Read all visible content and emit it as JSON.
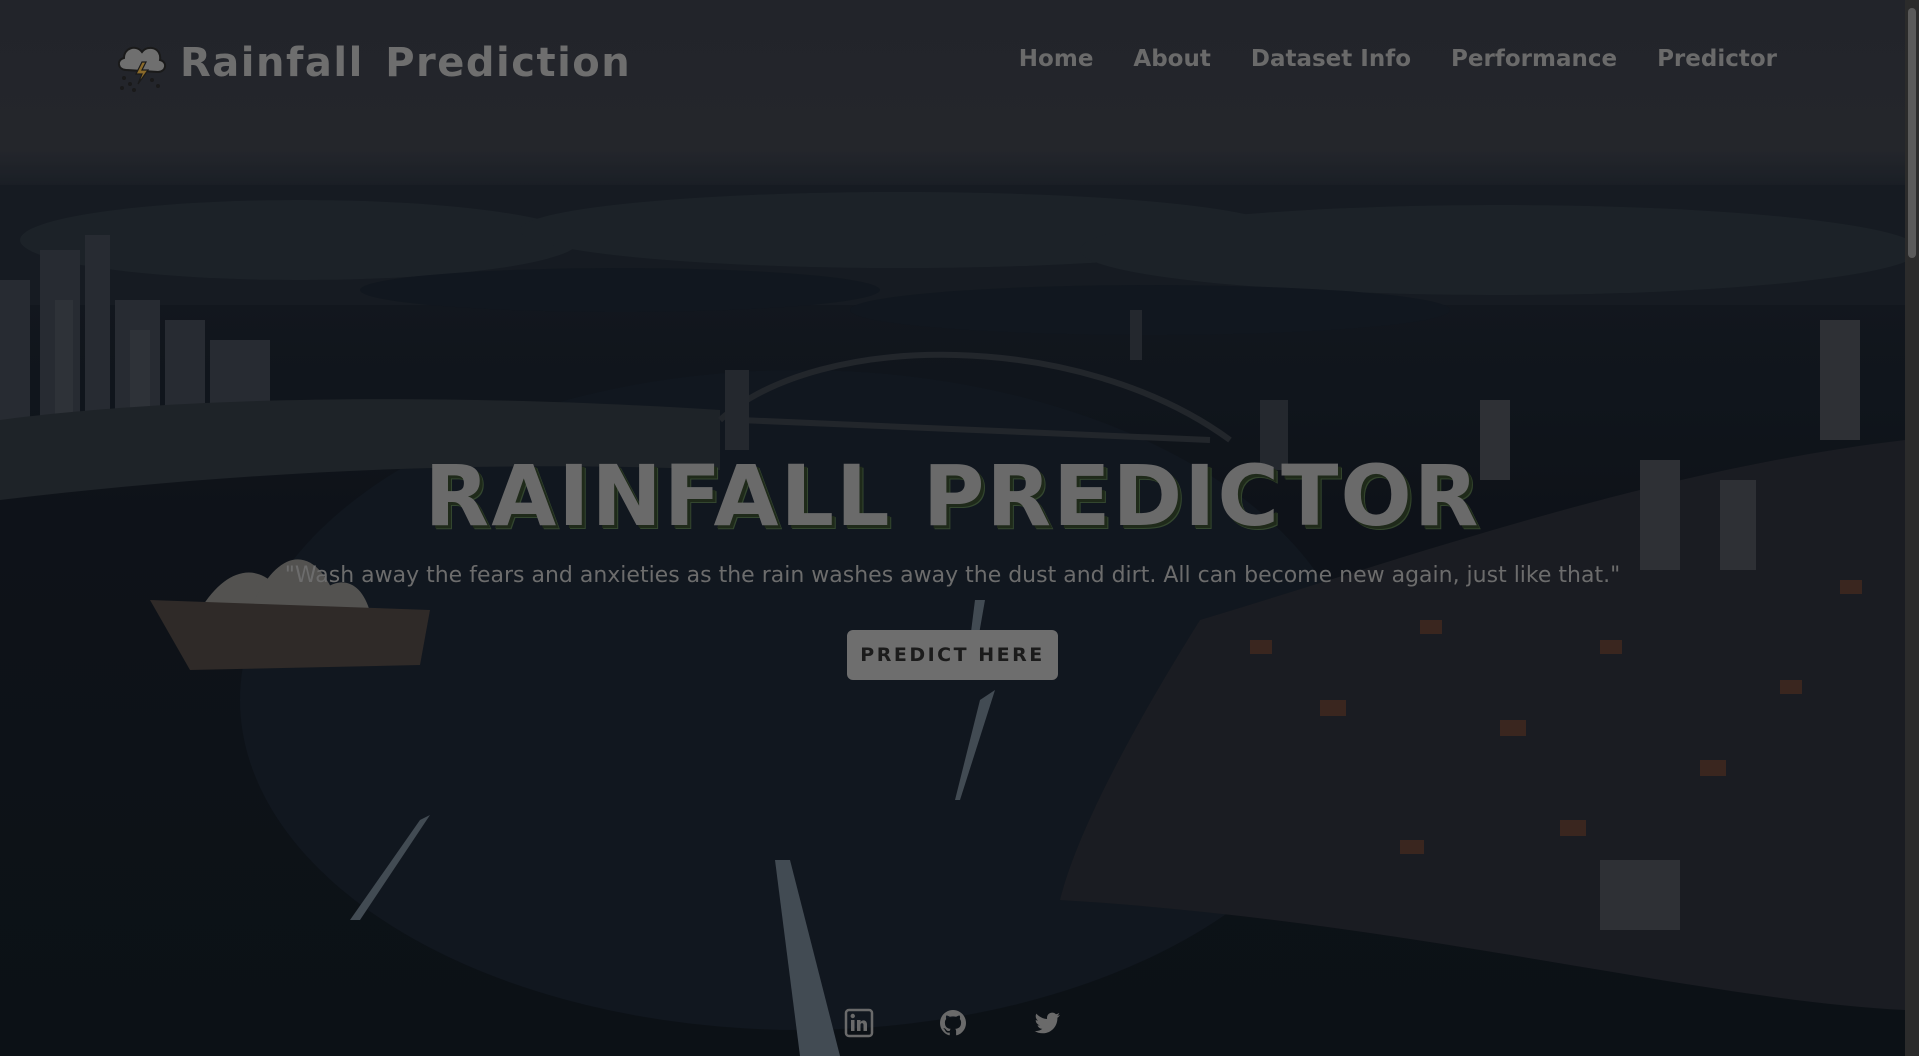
{
  "brand": {
    "title": "Rainfall Prediction",
    "icon": "thunderstorm-cloud-icon"
  },
  "nav": {
    "items": [
      {
        "label": "Home"
      },
      {
        "label": "About"
      },
      {
        "label": "Dataset Info"
      },
      {
        "label": "Performance"
      },
      {
        "label": "Predictor"
      }
    ]
  },
  "hero": {
    "title": "RAINFALL PREDICTOR",
    "quote": "\"Wash away the fears and anxieties as the rain washes away the dust and dirt. All can become new again, just like that.\"",
    "cta_label": "PREDICT HERE"
  },
  "socials": [
    {
      "icon": "linkedin-icon"
    },
    {
      "icon": "github-icon"
    },
    {
      "icon": "twitter-icon"
    }
  ],
  "colors": {
    "text_dim": "#6a6a6a",
    "button_bg": "#6e6e6e",
    "background": "#0b0e13"
  }
}
